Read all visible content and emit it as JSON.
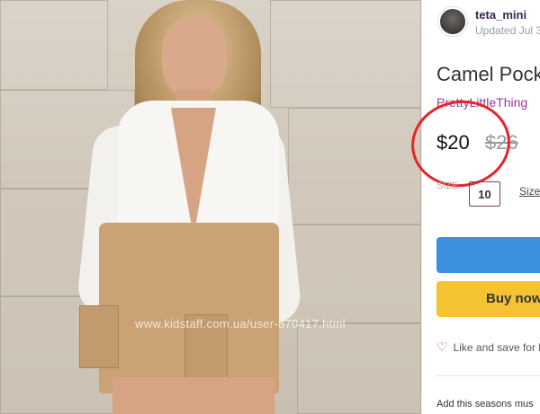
{
  "photo": {
    "watermark": "www.kidstaff.com.ua/user-870417.html"
  },
  "seller": {
    "name": "teta_mini",
    "updated": "Updated Jul 3"
  },
  "product": {
    "title": "Camel Pock",
    "brand": "PrettyLittleThing",
    "price": "$20",
    "old_price": "$26",
    "size_label": "SIZE",
    "size_value": "10",
    "size_guide": "Size"
  },
  "actions": {
    "buy_now": "Buy now",
    "like": "Like and save for la"
  },
  "description": {
    "text": "Add this seasons mus"
  },
  "colors": {
    "annotation_circle": "#e3262a",
    "brand": "#a2359b",
    "buy_button": "#3d8fe0",
    "buy_now_button": "#f5c232"
  }
}
